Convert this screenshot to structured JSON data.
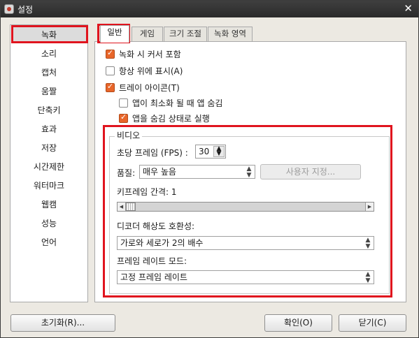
{
  "window": {
    "title": "설정",
    "close_glyph": "✕"
  },
  "sidebar": {
    "items": [
      {
        "label": "녹화"
      },
      {
        "label": "소리"
      },
      {
        "label": "캡처"
      },
      {
        "label": "움짤"
      },
      {
        "label": "단축키"
      },
      {
        "label": "효과"
      },
      {
        "label": "저장"
      },
      {
        "label": "시간제한"
      },
      {
        "label": "워터마크"
      },
      {
        "label": "웹캠"
      },
      {
        "label": "성능"
      },
      {
        "label": "언어"
      }
    ],
    "selected_index": 0
  },
  "tabs": [
    {
      "label": "일반"
    },
    {
      "label": "게임"
    },
    {
      "label": "크기 조절"
    },
    {
      "label": "녹화 영역"
    }
  ],
  "options": {
    "include_cursor": {
      "label": "녹화 시 커서 포함",
      "checked": true
    },
    "always_on_top": {
      "label": "항상 위에 표시(A)",
      "checked": false
    },
    "tray_icon": {
      "label": "트레이 아이콘(T)",
      "checked": true
    },
    "hide_when_minimized": {
      "label": "앱이 최소화 될 때 앱 숨김",
      "checked": false
    },
    "start_hidden": {
      "label": "앱을 숨김 상태로 실행",
      "checked": true
    }
  },
  "video": {
    "group_title": "비디오",
    "fps_label": "초당 프레임 (FPS) :",
    "fps_value": "30",
    "quality_label": "품질:",
    "quality_value": "매우 높음",
    "custom_button": "사용자 지정...",
    "keyframe_label": "키프레임 간격: 1",
    "keyframe_value": 1,
    "decoder_label": "디코더 해상도 호환성:",
    "decoder_value": "가로와 세로가 2의 배수",
    "framerate_mode_label": "프레임 레이트 모드:",
    "framerate_mode_value": "고정 프레임 레이트"
  },
  "buttons": {
    "reset": "초기화(R)...",
    "ok": "확인(O)",
    "close": "닫기(C)"
  },
  "colors": {
    "highlight": "#e0141e",
    "checkbox_accent": "#e8662a"
  },
  "icons": [
    "app-icon",
    "close-icon",
    "spin-arrows-icon",
    "chevron-updown-icon",
    "scroll-left-icon",
    "scroll-right-icon"
  ]
}
